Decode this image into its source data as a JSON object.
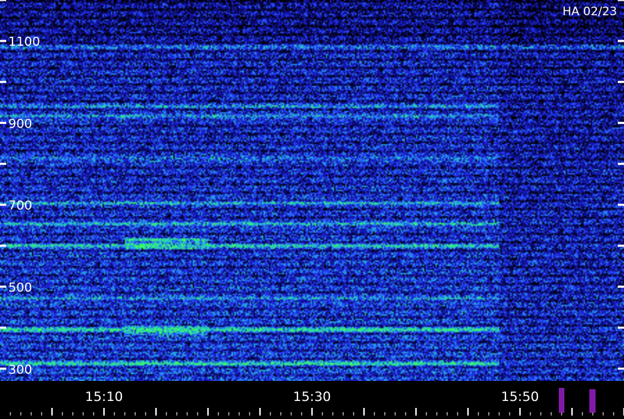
{
  "chart_data": {
    "type": "heatmap",
    "title": "",
    "stamp": "HA 02/23",
    "xlabel": "",
    "ylabel": "",
    "x_ticks": [
      {
        "value": 10,
        "label": "15:10"
      },
      {
        "value": 30,
        "label": "15:30"
      },
      {
        "value": 50,
        "label": "15:50"
      }
    ],
    "x_minor_ticks": [
      5,
      10,
      15,
      20,
      25,
      30,
      35,
      40,
      45,
      50,
      55,
      60
    ],
    "y_ticks": [
      {
        "value": 300,
        "label": "300"
      },
      {
        "value": 400,
        "label": ""
      },
      {
        "value": 500,
        "label": "500"
      },
      {
        "value": 600,
        "label": ""
      },
      {
        "value": 700,
        "label": "700"
      },
      {
        "value": 800,
        "label": ""
      },
      {
        "value": 900,
        "label": "900"
      },
      {
        "value": 1000,
        "label": ""
      },
      {
        "value": 1100,
        "label": "1100"
      },
      {
        "value": 1200,
        "label": ""
      }
    ],
    "xlim": [
      0,
      60
    ],
    "ylim": [
      270,
      1200
    ],
    "y_tick_marks_both_sides": true,
    "colormap": [
      "#000000",
      "#0a0a6e",
      "#1818c8",
      "#2a4cff",
      "#24a6e8",
      "#2ae0a0",
      "#3cff5a"
    ],
    "bright_bands": [
      {
        "freq": 312,
        "t_start": 0,
        "t_end": 48,
        "intensity": 0.85
      },
      {
        "freq": 395,
        "t_start": 0,
        "t_end": 48,
        "intensity": 0.95
      },
      {
        "freq": 470,
        "t_start": 0,
        "t_end": 48,
        "intensity": 0.55
      },
      {
        "freq": 600,
        "t_start": 0,
        "t_end": 48,
        "intensity": 0.8
      },
      {
        "freq": 652,
        "t_start": 0,
        "t_end": 48,
        "intensity": 0.85
      },
      {
        "freq": 705,
        "t_start": 0,
        "t_end": 48,
        "intensity": 0.7
      },
      {
        "freq": 812,
        "t_start": 0,
        "t_end": 48,
        "intensity": 0.6
      },
      {
        "freq": 915,
        "t_start": 0,
        "t_end": 48,
        "intensity": 0.75
      },
      {
        "freq": 940,
        "t_start": 0,
        "t_end": 48,
        "intensity": 0.6
      },
      {
        "freq": 1085,
        "t_start": 0,
        "t_end": 60,
        "intensity": 0.45
      }
    ],
    "bright_regions": [
      {
        "t_start": 12,
        "t_end": 20,
        "f_start": 590,
        "f_end": 620,
        "intensity": 0.85
      },
      {
        "t_start": 12,
        "t_end": 20,
        "f_start": 380,
        "f_end": 405,
        "intensity": 0.8
      }
    ],
    "colors": {
      "text": "#ffffff",
      "ticks": "#ffffff",
      "burst": "#a020d0"
    }
  }
}
